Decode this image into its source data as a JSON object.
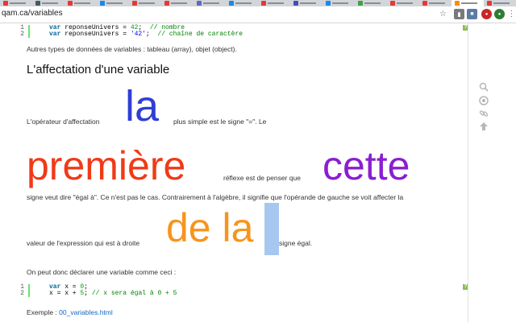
{
  "browser": {
    "url": "qam.ca/variables",
    "star_icon": "star-icon",
    "tab_colors": [
      "#e53935",
      "#455a64",
      "#e53935",
      "#1e88e5",
      "#e53935",
      "#e53935",
      "#5c6bc0",
      "#1e88e5",
      "#e53935",
      "#3f51b5",
      "#1e88e5",
      "#43a047",
      "#e53935",
      "#e53935",
      "#fb8c00",
      "#e53935"
    ]
  },
  "code_blocks": [
    {
      "lines": [
        {
          "n": "1",
          "kw": "var",
          "id": " reponseUnivers = ",
          "val": "42",
          "val_type": "num",
          "rest": ";  ",
          "cmt": "// nombre"
        },
        {
          "n": "2",
          "kw": "var",
          "id": " reponseUnivers = ",
          "val": "'42'",
          "val_type": "str",
          "rest": ";  ",
          "cmt": "// chaîne de caractère"
        }
      ]
    },
    {
      "lines": [
        {
          "n": "1",
          "kw": "var",
          "id": " x = ",
          "val": "0",
          "val_type": "num",
          "rest": ";",
          "cmt": ""
        },
        {
          "n": "2",
          "kw": "",
          "id": "x = x + ",
          "val": "5",
          "val_type": "num",
          "rest": "; ",
          "cmt": "// x sera égal à 0 + 5"
        }
      ]
    }
  ],
  "paragraphs": {
    "autres_types": "Autres types de données de variables  : tableau (array), objet (object).",
    "heading": "L'affectation d'une variable",
    "p1_before": "L'opérateur d'affectation",
    "p1_after": "plus simple est le signe \"=\". Le",
    "p2_mid": "réflexe est de penser que",
    "p3": "signe veut dire \"égal à\". Ce n'est pas le cas. Contrairement à l'algèbre, il signifie que l'opérande de gauche se voit affecter la",
    "p4_before": "valeur de l'expression qui est à droite",
    "p4_after": "signe égal.",
    "p5": "On peut donc déclarer une variable comme ceci  :",
    "exemple_label": "Exemple : ",
    "exemple_link": "00_variables.html"
  },
  "overlay_words": {
    "la": {
      "text": "la",
      "color": "#2f3fd6"
    },
    "premiere": {
      "text": "première",
      "color": "#f03a17"
    },
    "cette": {
      "text": "cette",
      "color": "#8a1fd0"
    },
    "dela": {
      "text": "de la",
      "color": "#f7941d"
    }
  },
  "side_tools": [
    "search-icon",
    "settings-icon",
    "link-icon",
    "up-arrow-icon"
  ]
}
